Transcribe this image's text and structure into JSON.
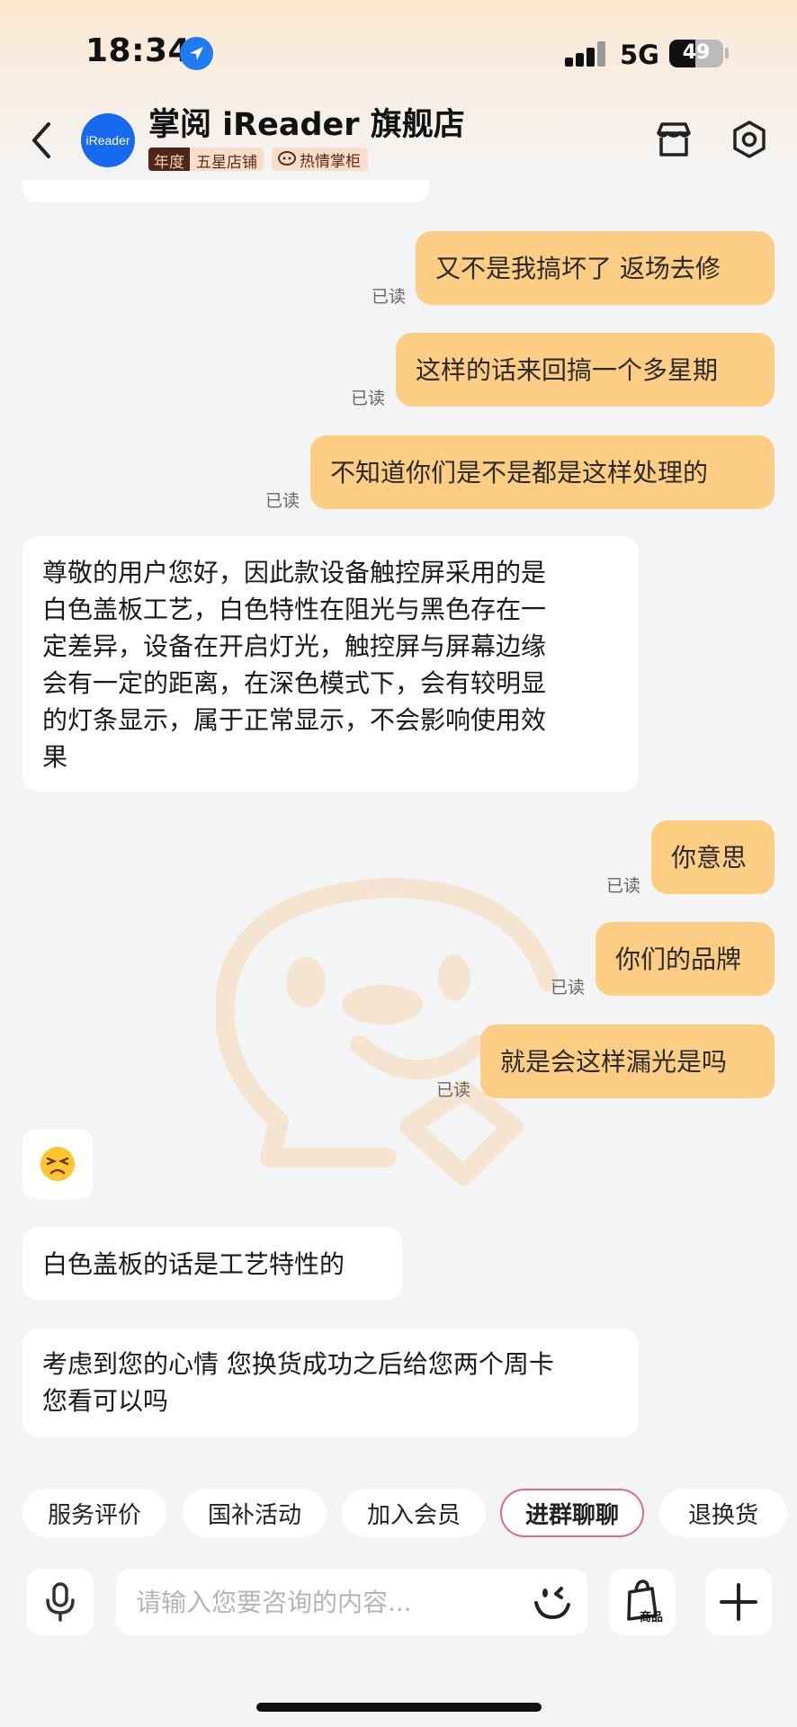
{
  "status_bar": {
    "time": "18:34",
    "network": "5G",
    "battery": "49",
    "battery_level": 0.49
  },
  "header": {
    "shop_name": "掌阅 iReader 旗舰店",
    "avatar_text": "iReader",
    "badge_year": "年度",
    "badge_rating": "五星店铺",
    "badge_hot": "热情掌柜",
    "accent_color": "#fccd82"
  },
  "messages": [
    {
      "side": "me",
      "text": "又不是我搞坏了 返场去修",
      "status": "已读"
    },
    {
      "side": "me",
      "text": "这样的话来回搞一个多星期",
      "status": "已读"
    },
    {
      "side": "me",
      "text": "不知道你们是不是都是这样处理的",
      "status": "已读"
    },
    {
      "side": "them",
      "lines": [
        "尊敬的用户您好，因此款设备触控屏采用的是",
        "白色盖板工艺，白色特性在阻光与黑色存在一",
        "定差异，设备在开启灯光，触控屏与屏幕边缘",
        "会有一定的距离，在深色模式下，会有较明显",
        "的灯条显示，属于正常显示，不会影响使用效",
        "果"
      ]
    },
    {
      "side": "me",
      "text": "你意思",
      "status": "已读"
    },
    {
      "side": "me",
      "text": "你们的品牌",
      "status": "已读"
    },
    {
      "side": "me",
      "text": "就是会这样漏光是吗",
      "status": "已读"
    },
    {
      "side": "them",
      "emoji": "😣"
    },
    {
      "side": "them",
      "text": "白色盖板的话是工艺特性的"
    },
    {
      "side": "them",
      "lines": [
        "考虑到您的心情 您换货成功之后给您两个周卡",
        "您看可以吗"
      ]
    }
  ],
  "quick_replies": [
    "服务评价",
    "国补活动",
    "加入会员",
    "进群聊聊",
    "退换货"
  ],
  "input": {
    "placeholder": "请输入您要咨询的内容...",
    "value": "",
    "goods_label": "商品"
  },
  "icons": [
    "location-arrow-icon",
    "signal-icon",
    "battery-icon",
    "back-icon",
    "store-icon",
    "settings-icon",
    "microphone-icon",
    "emoji-icon",
    "shopping-bag-icon",
    "plus-icon"
  ]
}
